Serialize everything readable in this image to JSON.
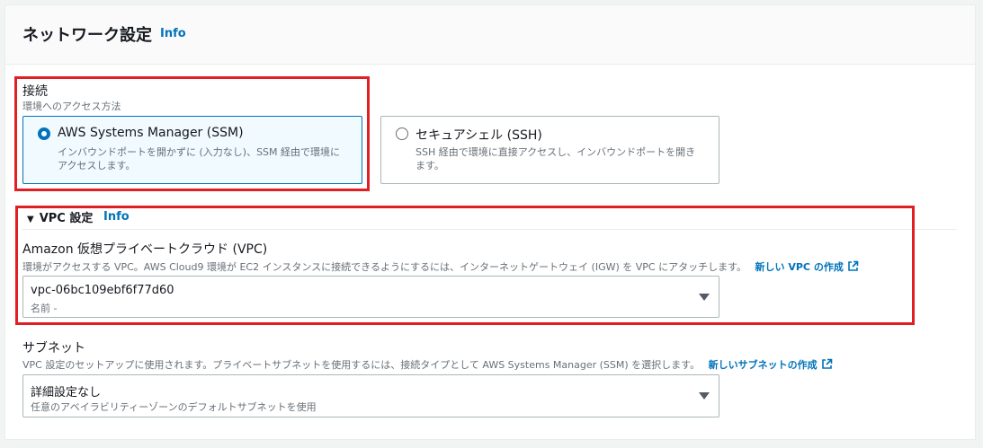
{
  "header": {
    "title": "ネットワーク設定",
    "info": "Info"
  },
  "connection": {
    "label": "接続",
    "description": "環境へのアクセス方法",
    "options": [
      {
        "title": "AWS Systems Manager (SSM)",
        "description": "インバウンドポートを開かずに (入力なし)、SSM 経由で環境にアクセスします。",
        "selected": true
      },
      {
        "title": "セキュアシェル (SSH)",
        "description": "SSH 経由で環境に直接アクセスし、インバウンドポートを開きます。",
        "selected": false
      }
    ]
  },
  "vpc_settings": {
    "title": "VPC 設定",
    "info": "Info",
    "expanded": true
  },
  "vpc": {
    "label": "Amazon 仮想プライベートクラウド (VPC)",
    "description": "環境がアクセスする VPC。AWS Cloud9 環境が EC2 インスタンスに接続できるようにするには、インターネットゲートウェイ (IGW) を VPC にアタッチします。",
    "link": "新しい VPC の作成",
    "value": "vpc-06bc109ebf6f77d60",
    "sub": "名前 -"
  },
  "subnet": {
    "label": "サブネット",
    "description": "VPC 設定のセットアップに使用されます。プライベートサブネットを使用するには、接続タイプとして AWS Systems Manager (SSM) を選択します。",
    "link": "新しいサブネットの作成",
    "value": "詳細設定なし",
    "sub": "任意のアベイラビリティーゾーンのデフォルトサブネットを使用"
  },
  "colors": {
    "accent": "#0073bb",
    "highlight": "#e21e25",
    "text": "#16191f",
    "muted": "#687078"
  }
}
